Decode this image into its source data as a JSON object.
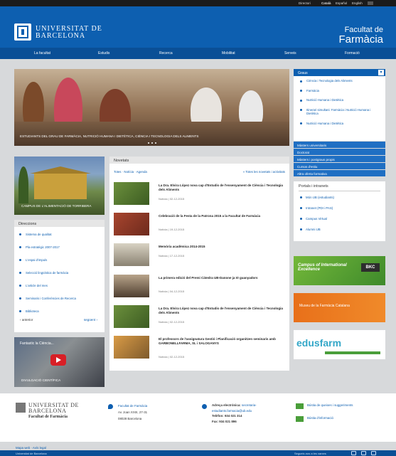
{
  "topbar": {
    "directori": "Directori",
    "lang_ca": "Català",
    "lang_es": "Español",
    "lang_en": "English"
  },
  "header": {
    "university_line1": "UNIVERSITAT DE",
    "university_line2": "BARCELONA",
    "faculty_line1": "Facultat de",
    "faculty_line2": "Farmàcia"
  },
  "nav": [
    "La facultat",
    "Estudis",
    "Recerca",
    "Mobilitat",
    "Serveis",
    "Formació"
  ],
  "hero": {
    "caption": "ESTUDIANTS DEL GRAU DE FARMÀCIA, NUTRICIÓ HUMANA I DIETÈTICA, CIÈNCIA I TECNOLOGIA DELS ALIMENTS"
  },
  "graus": {
    "title": "Graus",
    "items": [
      "Ciència i Tecnologia dels Aliments",
      "Farmàcia",
      "Nutrició Humana i Dietètica",
      "Itinerari simultani: Farmàcia i Nutrició Humana i Dietètica",
      "Nutrició Humana i Dietètica"
    ]
  },
  "study_links": [
    "Màsters universitaris",
    "Doctorat",
    "Màsters i postgraus propis",
    "Cursos d'estiu",
    "Altra oferta formativa"
  ],
  "portals": {
    "title": "Portals i intranets",
    "items": [
      "Món UB (estudiants)",
      "Intranet (PDI i PAS)",
      "Campus Virtual",
      "Alumni UB"
    ]
  },
  "banners": {
    "campus_title": "Campus of International Excellence",
    "campus_badge": "BKC",
    "museum": "Museu de la Farmàcia Catalana",
    "edusfarm": "edusfarm"
  },
  "campus_box": {
    "caption": "CAMPUS DE L'ALIMENTACIÓ DE TORRIBERA"
  },
  "direccions": {
    "title": "Direccions",
    "items": [
      "Sistema de qualitat",
      "Pla estratègic 2007-2017",
      "L'espai d'impuls",
      "Selecció lingüística de farmàcia",
      "L'article del mes",
      "Seminaris i Conferències de Recerca",
      "Biblioteca"
    ],
    "prev": "anterior",
    "next": "següent"
  },
  "video": {
    "title": "Fantastic la Ciència...",
    "caption": "DIVULGACIÓ CIENTÍFICA"
  },
  "news": {
    "title": "Novetats",
    "filters": "Totes · Notícia · Agenda",
    "all_link": "» Totes les novetats i activitats",
    "items": [
      {
        "title": "La Dra. Elvira López nova cap d'Estudis de l'ensenyament de Ciència i Tecnologia dels Aliments",
        "meta": "Notícia | 02-12-2015"
      },
      {
        "title": "Celebració de la Festa de la Patrona 2015 a la Facultat de Farmàcia",
        "meta": "Notícia | 19-12-2015"
      },
      {
        "title": "Memòria acadèmica 2014-2015",
        "meta": "Notícia | 17-12-2015"
      },
      {
        "title": "La primera edició del Premi Càtedra UB-Danone ja té guanyadors",
        "meta": "Notícia | 04-12-2015"
      },
      {
        "title": "La Dra. Elvira López nova cap d'Estudis de l'ensenyament de Ciència i Tecnologia dels Aliments",
        "meta": "Notícia | 02-12-2015"
      },
      {
        "title": "El professors de l'assignatura Gestió i Planificació organitzen seminaris amb GARBONELLFARMA, SL i SALOGANYS",
        "meta": "Notícia | 02-12-2015"
      }
    ]
  },
  "footer": {
    "university_line1": "UNIVERSITAT DE",
    "university_line2": "BARCELONA",
    "faculty": "Facultat de Farmàcia",
    "address_title": "Facultat de Farmàcia",
    "address1": "Av. Joan XXIII, 27-31",
    "address2": "08028 Barcelona",
    "email_label": "Adreça electrònica:",
    "email1": "secretaria-",
    "email2": "estudiants.farmacia@ub.edu",
    "phone": "Telèfon: 934 021 314",
    "fax": "Fax: 934 021 896",
    "suggestions": "Bústia de queixes i suggeriments",
    "info": "Bústia d'informació",
    "links": "Mapa web  ·  Avís legal",
    "copyright": "Universitat de Barcelona",
    "follow": "Segueix-nos a les xarxes"
  }
}
